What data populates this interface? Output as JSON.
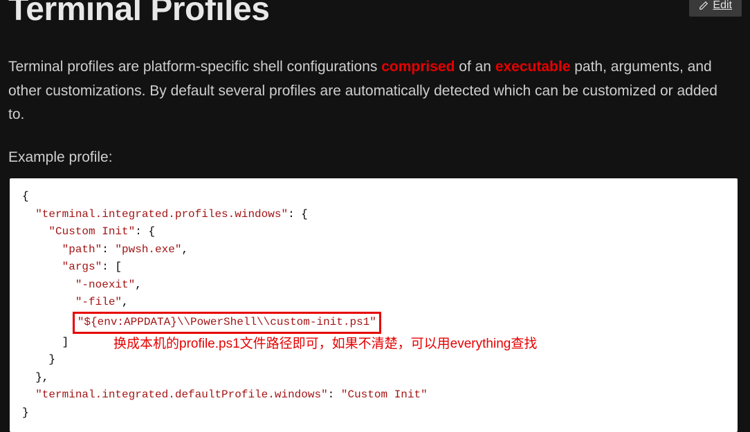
{
  "header": {
    "title": "Terminal Profiles",
    "edit_label": "Edit"
  },
  "description": {
    "part1": "Terminal profiles are platform-specific shell configurations ",
    "hl1": "comprised",
    "part2": " of an ",
    "hl2": "executable",
    "part3": " path, arguments, and other customizations. By default several profiles are automatically detected which can be customized or added to."
  },
  "sub_label": "Example profile:",
  "code": {
    "key_profiles": "\"terminal.integrated.profiles.windows\"",
    "key_custom": "\"Custom Init\"",
    "key_path": "\"path\"",
    "val_path": "\"pwsh.exe\"",
    "key_args": "\"args\"",
    "arg1": "\"-noexit\"",
    "arg2": "\"-file\"",
    "arg3": "\"${env:APPDATA}\\\\PowerShell\\\\custom-init.ps1\"",
    "key_default": "\"terminal.integrated.defaultProfile.windows\"",
    "val_default": "\"Custom Init\""
  },
  "annotation": "换成本机的profile.ps1文件路径即可，如果不清楚，可以用everything查找"
}
